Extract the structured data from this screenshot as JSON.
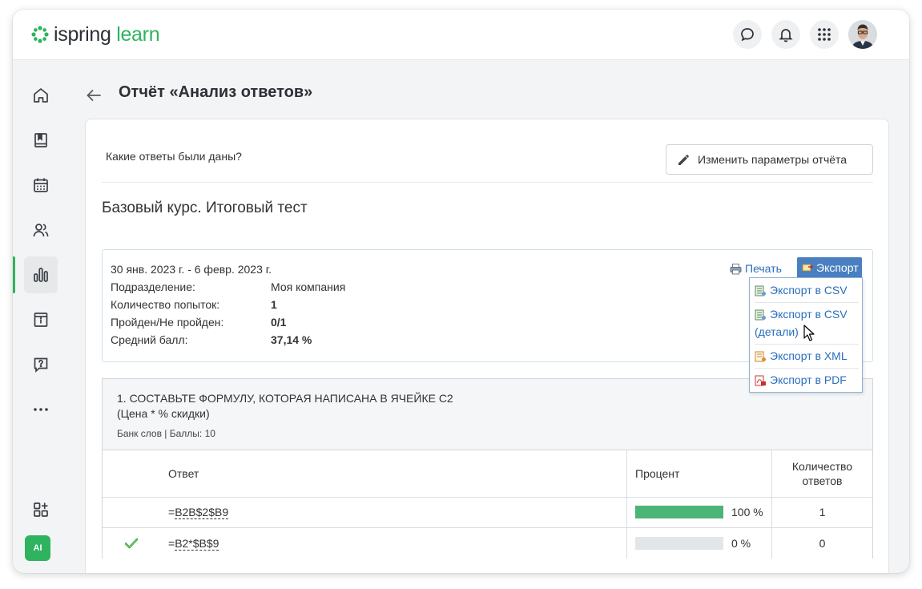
{
  "brand": {
    "name_part1": "ispring",
    "name_part2": "learn",
    "green": "#2fb35f"
  },
  "header": {
    "icons": [
      "chat-icon",
      "bell-icon",
      "apps-grid-icon"
    ],
    "avatar": "user-avatar"
  },
  "sidebar": {
    "items": [
      {
        "icon": "home-icon"
      },
      {
        "icon": "book-icon"
      },
      {
        "icon": "calendar-icon"
      },
      {
        "icon": "users-icon"
      },
      {
        "icon": "reports-icon",
        "active": true
      },
      {
        "icon": "info-page-icon"
      },
      {
        "icon": "question-chat-icon"
      },
      {
        "icon": "more-icon"
      }
    ],
    "add_widget_icon": "add-widget-icon",
    "ai_label": "AI"
  },
  "page": {
    "title": "Отчёт «Анализ ответов»",
    "question_prompt": "Какие ответы были даны?",
    "edit_button": "Изменить параметры отчёта",
    "test_title": "Базовый курс. Итоговый тест"
  },
  "summary": {
    "period": "30 янв. 2023 г. - 6 февр. 2023 г.",
    "rows": [
      {
        "label": "Подразделение:",
        "value": "Моя компания",
        "bold": false
      },
      {
        "label": "Количество попыток:",
        "value": "1",
        "bold": true
      },
      {
        "label": "Пройден/Не пройден:",
        "value": "0/1",
        "bold": true
      },
      {
        "label": "Средний балл:",
        "value": "37,14 %",
        "bold": true
      }
    ],
    "print_label": "Печать",
    "export_label": "Экспорт"
  },
  "export_menu": {
    "items": [
      {
        "label": "Экспорт в CSV",
        "icon": "csv-icon"
      },
      {
        "label": "Экспорт в CSV",
        "label2": "(детали)",
        "icon": "csv-icon"
      },
      {
        "label": "Экспорт в XML",
        "icon": "xml-icon"
      },
      {
        "label": "Экспорт в PDF",
        "icon": "pdf-icon"
      }
    ]
  },
  "question": {
    "title_line1": "1. СОСТАВЬТЕ ФОРМУЛУ, КОТОРАЯ НАПИСАНА В ЯЧЕЙКЕ С2",
    "title_line2": "(Цена * % скидки)",
    "meta": "Банк слов | Баллы: 10",
    "columns": {
      "answer": "Ответ",
      "percent": "Процент",
      "count_line1": "Количество",
      "count_line2": "ответов"
    },
    "answers": [
      {
        "prefix": "=",
        "formula": "B2B$2$B9",
        "percent": 100,
        "percent_label": "100 %",
        "count": "1",
        "correct": false
      },
      {
        "prefix": "=",
        "formula": "B2*$B$9",
        "percent": 0,
        "percent_label": "0 %",
        "count": "0",
        "correct": true
      }
    ]
  }
}
